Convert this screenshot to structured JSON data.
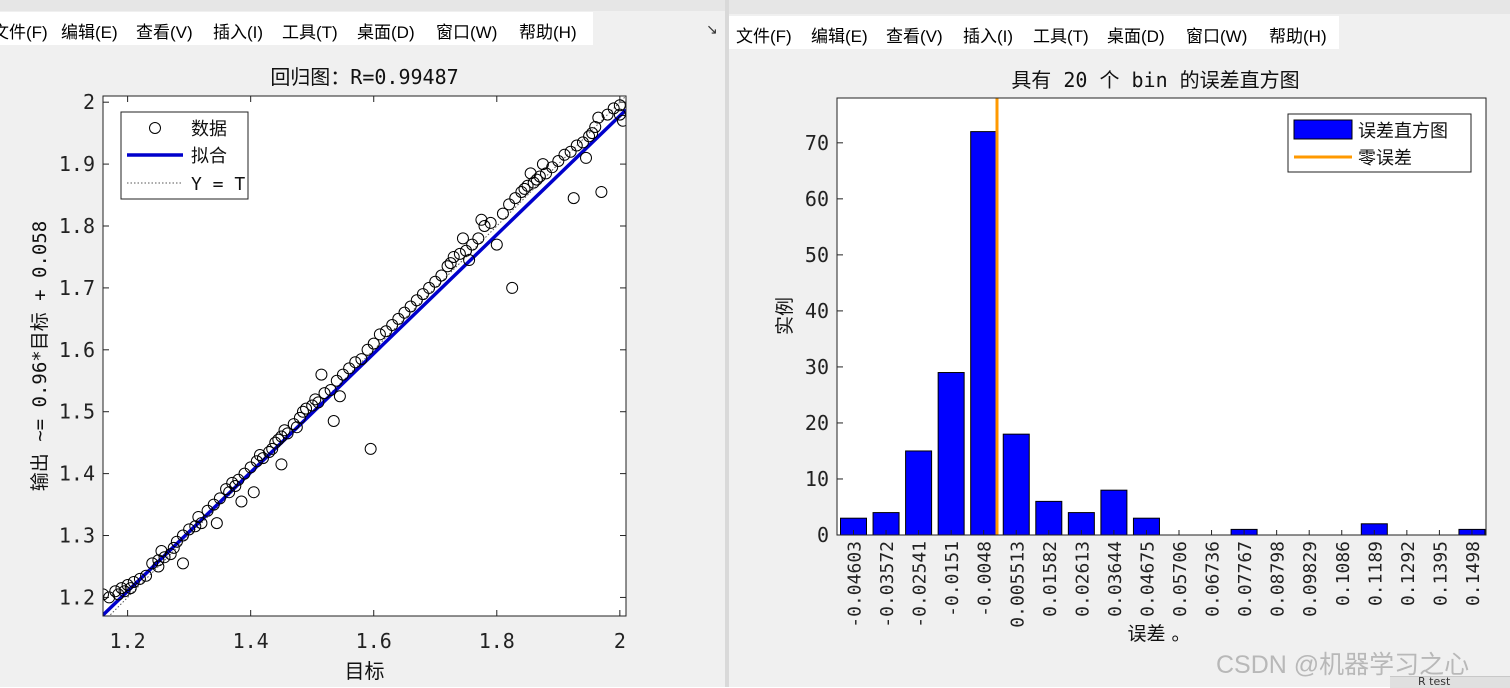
{
  "left_window": {
    "menu": [
      "文件(F)",
      "编辑(E)",
      "查看(V)",
      "插入(I)",
      "工具(T)",
      "桌面(D)",
      "窗口(W)",
      "帮助(H)"
    ],
    "dock_icon": "dock-arrow-icon"
  },
  "right_window": {
    "menu": [
      "文件(F)",
      "编辑(E)",
      "查看(V)",
      "插入(I)",
      "工具(T)",
      "桌面(D)",
      "窗口(W)",
      "帮助(H)"
    ]
  },
  "watermark": "CSDN @机器学习之心",
  "corner_text": "R test",
  "chart_data": [
    {
      "type": "scatter",
      "title": "回归图：R=0.99487",
      "xlabel": "目标",
      "ylabel": "输出 ~= 0.96*目标 + 0.058",
      "xlim": [
        1.16,
        2.01
      ],
      "ylim": [
        1.17,
        2.01
      ],
      "xticks": [
        1.2,
        1.4,
        1.6,
        1.8,
        2
      ],
      "xtick_labels": [
        "1.2",
        "1.4",
        "1.6",
        "1.8",
        "2"
      ],
      "yticks": [
        1.2,
        1.3,
        1.4,
        1.5,
        1.6,
        1.7,
        1.8,
        1.9,
        2
      ],
      "ytick_labels": [
        "1.2",
        "1.3",
        "1.4",
        "1.5",
        "1.6",
        "1.7",
        "1.8",
        "1.9",
        "2"
      ],
      "legend_position": "top-left",
      "legend": [
        "数据",
        "拟合",
        "Y = T"
      ],
      "colors": {
        "data": "#000000",
        "fit": "#0000cc",
        "identity": "#555555"
      },
      "fit": {
        "slope": 0.96,
        "intercept": 0.058
      },
      "points": [
        [
          1.16,
          1.205
        ],
        [
          1.17,
          1.2
        ],
        [
          1.18,
          1.21
        ],
        [
          1.185,
          1.205
        ],
        [
          1.19,
          1.215
        ],
        [
          1.195,
          1.21
        ],
        [
          1.2,
          1.22
        ],
        [
          1.205,
          1.215
        ],
        [
          1.21,
          1.225
        ],
        [
          1.22,
          1.23
        ],
        [
          1.23,
          1.235
        ],
        [
          1.24,
          1.255
        ],
        [
          1.25,
          1.26
        ],
        [
          1.25,
          1.25
        ],
        [
          1.255,
          1.275
        ],
        [
          1.26,
          1.265
        ],
        [
          1.27,
          1.27
        ],
        [
          1.275,
          1.28
        ],
        [
          1.28,
          1.29
        ],
        [
          1.29,
          1.3
        ],
        [
          1.29,
          1.255
        ],
        [
          1.3,
          1.31
        ],
        [
          1.31,
          1.315
        ],
        [
          1.315,
          1.33
        ],
        [
          1.32,
          1.32
        ],
        [
          1.33,
          1.34
        ],
        [
          1.34,
          1.35
        ],
        [
          1.345,
          1.32
        ],
        [
          1.35,
          1.36
        ],
        [
          1.36,
          1.375
        ],
        [
          1.365,
          1.37
        ],
        [
          1.37,
          1.385
        ],
        [
          1.375,
          1.38
        ],
        [
          1.38,
          1.39
        ],
        [
          1.385,
          1.355
        ],
        [
          1.39,
          1.4
        ],
        [
          1.4,
          1.41
        ],
        [
          1.405,
          1.37
        ],
        [
          1.41,
          1.42
        ],
        [
          1.415,
          1.43
        ],
        [
          1.42,
          1.425
        ],
        [
          1.43,
          1.435
        ],
        [
          1.435,
          1.44
        ],
        [
          1.44,
          1.45
        ],
        [
          1.445,
          1.455
        ],
        [
          1.45,
          1.46
        ],
        [
          1.455,
          1.47
        ],
        [
          1.45,
          1.415
        ],
        [
          1.46,
          1.465
        ],
        [
          1.47,
          1.48
        ],
        [
          1.475,
          1.475
        ],
        [
          1.48,
          1.49
        ],
        [
          1.485,
          1.5
        ],
        [
          1.49,
          1.505
        ],
        [
          1.5,
          1.51
        ],
        [
          1.505,
          1.52
        ],
        [
          1.51,
          1.515
        ],
        [
          1.515,
          1.56
        ],
        [
          1.52,
          1.53
        ],
        [
          1.53,
          1.535
        ],
        [
          1.535,
          1.485
        ],
        [
          1.54,
          1.55
        ],
        [
          1.545,
          1.525
        ],
        [
          1.55,
          1.56
        ],
        [
          1.56,
          1.57
        ],
        [
          1.57,
          1.58
        ],
        [
          1.58,
          1.585
        ],
        [
          1.59,
          1.6
        ],
        [
          1.595,
          1.44
        ],
        [
          1.6,
          1.61
        ],
        [
          1.61,
          1.625
        ],
        [
          1.62,
          1.63
        ],
        [
          1.63,
          1.64
        ],
        [
          1.64,
          1.65
        ],
        [
          1.65,
          1.66
        ],
        [
          1.66,
          1.67
        ],
        [
          1.67,
          1.68
        ],
        [
          1.68,
          1.69
        ],
        [
          1.69,
          1.7
        ],
        [
          1.7,
          1.71
        ],
        [
          1.71,
          1.72
        ],
        [
          1.72,
          1.735
        ],
        [
          1.725,
          1.74
        ],
        [
          1.73,
          1.75
        ],
        [
          1.74,
          1.755
        ],
        [
          1.745,
          1.78
        ],
        [
          1.75,
          1.76
        ],
        [
          1.755,
          1.745
        ],
        [
          1.76,
          1.77
        ],
        [
          1.77,
          1.78
        ],
        [
          1.775,
          1.81
        ],
        [
          1.78,
          1.8
        ],
        [
          1.79,
          1.805
        ],
        [
          1.8,
          1.77
        ],
        [
          1.81,
          1.82
        ],
        [
          1.82,
          1.835
        ],
        [
          1.825,
          1.7
        ],
        [
          1.83,
          1.845
        ],
        [
          1.84,
          1.855
        ],
        [
          1.845,
          1.86
        ],
        [
          1.85,
          1.865
        ],
        [
          1.855,
          1.885
        ],
        [
          1.86,
          1.87
        ],
        [
          1.865,
          1.875
        ],
        [
          1.87,
          1.88
        ],
        [
          1.875,
          1.9
        ],
        [
          1.88,
          1.885
        ],
        [
          1.89,
          1.895
        ],
        [
          1.9,
          1.905
        ],
        [
          1.91,
          1.915
        ],
        [
          1.92,
          1.92
        ],
        [
          1.925,
          1.845
        ],
        [
          1.93,
          1.93
        ],
        [
          1.94,
          1.935
        ],
        [
          1.945,
          1.91
        ],
        [
          1.95,
          1.945
        ],
        [
          1.955,
          1.95
        ],
        [
          1.96,
          1.96
        ],
        [
          1.965,
          1.975
        ],
        [
          1.97,
          1.855
        ],
        [
          1.98,
          1.98
        ],
        [
          1.99,
          1.99
        ],
        [
          2,
          1.995
        ],
        [
          2,
          1.98
        ],
        [
          2.005,
          1.97
        ]
      ]
    },
    {
      "type": "bar",
      "title": "具有 20 个 bin 的误差直方图",
      "xlabel": "误差 。",
      "ylabel": "实例",
      "ylim": [
        0,
        78
      ],
      "yticks": [
        0,
        10,
        20,
        30,
        40,
        50,
        60,
        70
      ],
      "ytick_labels": [
        "0",
        "10",
        "20",
        "30",
        "40",
        "50",
        "60",
        "70"
      ],
      "categories": [
        "-0.04603",
        "-0.03572",
        "-0.02541",
        "-0.0151",
        "-0.0048",
        "0.005513",
        "0.01582",
        "0.02613",
        "0.03644",
        "0.04675",
        "0.05706",
        "0.06736",
        "0.07767",
        "0.08798",
        "0.09829",
        "0.1086",
        "0.1189",
        "0.1292",
        "0.1395",
        "0.1498"
      ],
      "series": [
        {
          "name": "误差直方图",
          "values": [
            3,
            4,
            15,
            29,
            72,
            18,
            6,
            4,
            8,
            3,
            0,
            0,
            1,
            0,
            0,
            0,
            2,
            0,
            0,
            1
          ]
        }
      ],
      "zero_error_line": {
        "name": "零误差",
        "x": 0
      },
      "legend_position": "top-right",
      "colors": {
        "bars": "#0000ff",
        "zero_line": "#ff9900"
      }
    }
  ]
}
